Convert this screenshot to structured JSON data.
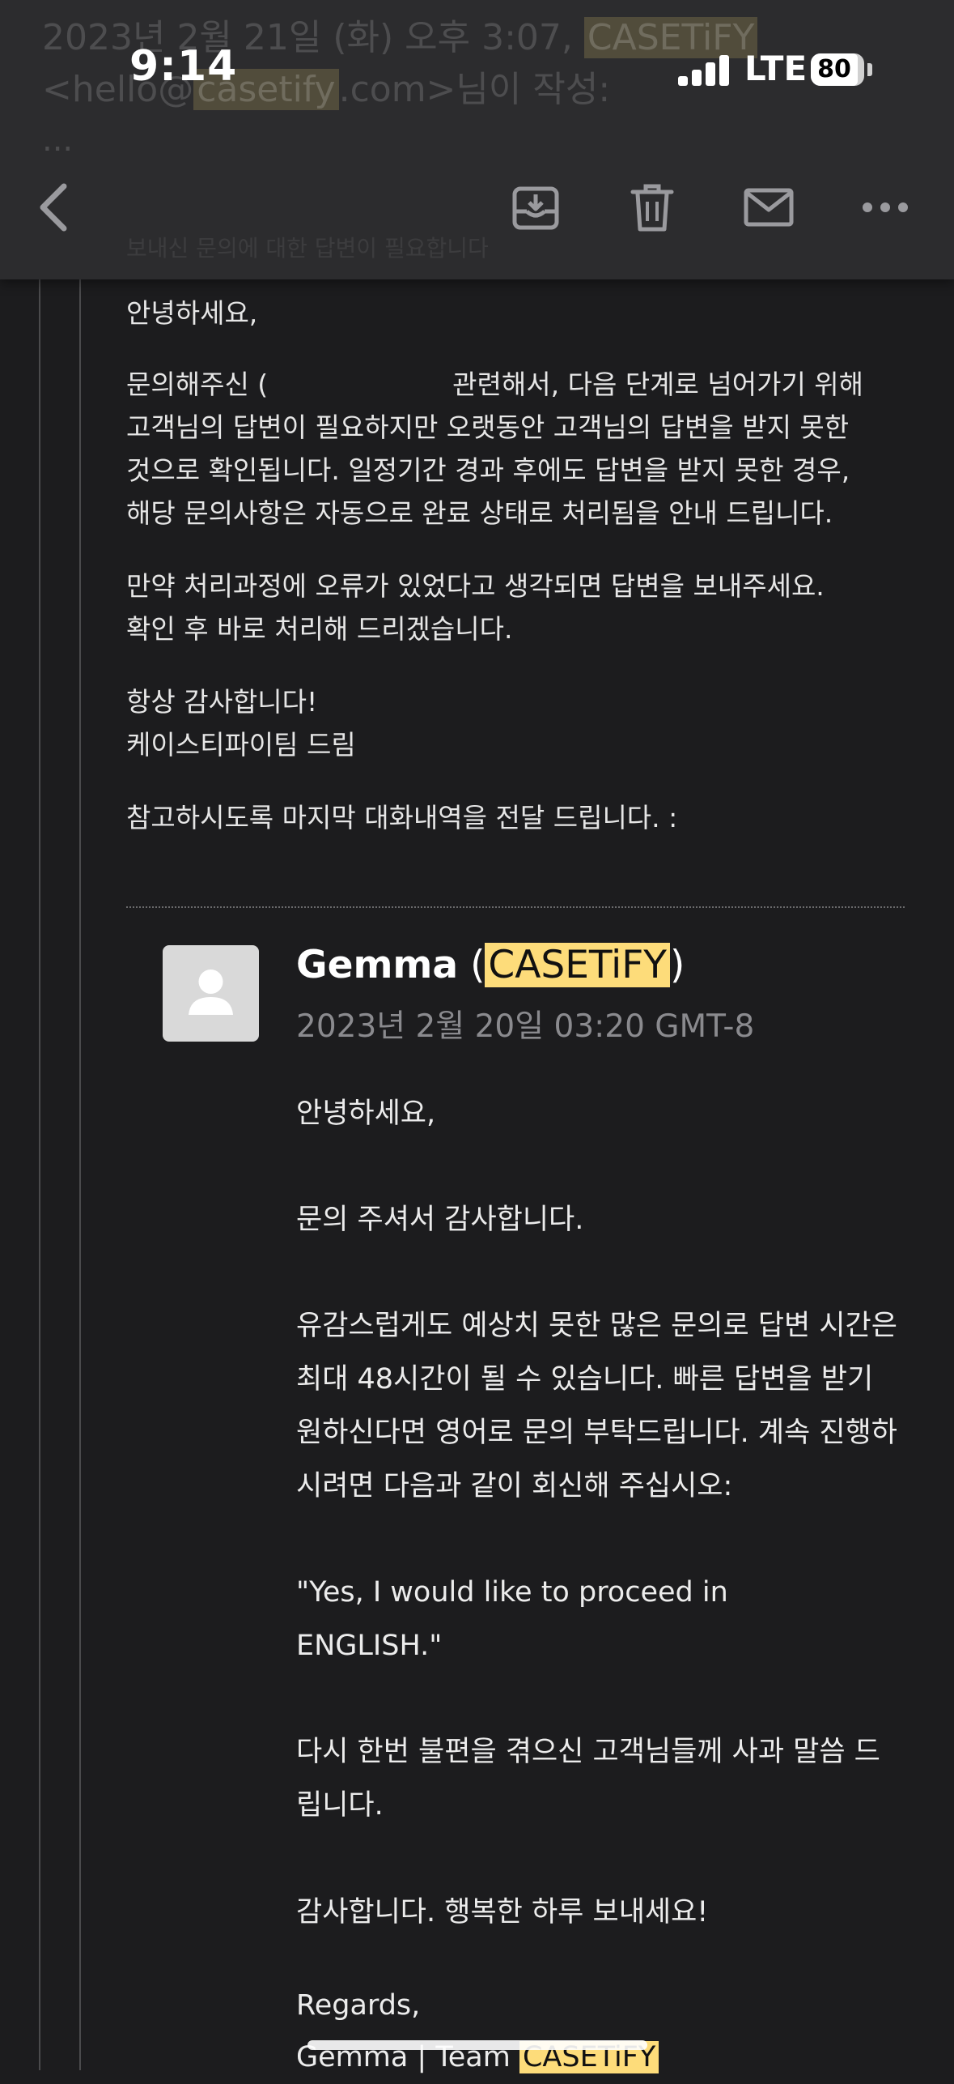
{
  "header": {
    "ghost_line1_prefix": "2023년 2월 21일 (화) 오후 3:07,",
    "ghost_line1_brand": "CASETiFY",
    "ghost_line2_a": "<hello@",
    "ghost_line2_brand": "casetify",
    "ghost_line2_b": ".com>님이 작성:",
    "ghost_more": "...",
    "ghost_behind": "보내신 문의에 대한 답변이 필요합니다"
  },
  "status_bar": {
    "time": "9:14",
    "network": "LTE",
    "battery": "80"
  },
  "toolbar": {
    "back": "back-chevron-icon",
    "archive": "archive-tray-icon",
    "delete": "trash-icon",
    "mail": "envelope-icon",
    "more": "more-dots-icon"
  },
  "quoted_email": {
    "greeting": "안녕하세요,",
    "p1_line1_a": "문의해주신 (",
    "p1_line1_b": "관련해서, 다음 단계로 넘어가기 위해",
    "p1_line2": "고객님의 답변이 필요하지만 오랫동안 고객님의 답변을 받지 못한",
    "p1_line3": "것으로 확인됩니다. 일정기간 경과 후에도 답변을 받지 못한 경우,",
    "p1_line4": "해당 문의사항은 자동으로 완료 상태로 처리됨을 안내 드립니다.",
    "p2_line1": "만약 처리과정에 오류가 있었다고 생각되면 답변을 보내주세요.",
    "p2_line2": "확인 후 바로 처리해 드리겠습니다.",
    "p3_line1": "항상 감사합니다!",
    "p3_line2": "케이스티파이팀 드림",
    "p4": "참고하시도록 마지막 대화내역을 전달 드립니다. :"
  },
  "message": {
    "sender_name": "Gemma",
    "sender_brand": "CASETiFY",
    "date": "2023년 2월 20일 03:20 GMT-8",
    "greeting": "안녕하세요,",
    "thanks": "문의 주셔서 감사합니다.",
    "p1_line1": "유감스럽게도 예상치 못한 많은 문의로 답변 시간은",
    "p1_line2": "최대 48시간이 될 수 있습니다. 빠른 답변을 받기",
    "p1_line3": "원하신다면 영어로 문의 부탁드립니다. 계속 진행하",
    "p1_line4": "시려면 다음과 같이 회신해 주십시오:",
    "quote_line1": "\"Yes, I would like to proceed in",
    "quote_line2": "ENGLISH.\"",
    "apology_line1": "다시 한번 불편을 겪으신 고객님들께 사과 말씀 드",
    "apology_line2": "립니다.",
    "closing": "감사합니다. 행복한 하루 보내세요!",
    "regards": "Regards,",
    "signature_prefix": "Gemma | Team",
    "signature_brand": "CASETiFY"
  },
  "colors": {
    "background": "#1c1c1e",
    "toolbar": "#2c2c2e",
    "highlight": "#fddc7a",
    "muted_text": "#8a8a8e"
  }
}
